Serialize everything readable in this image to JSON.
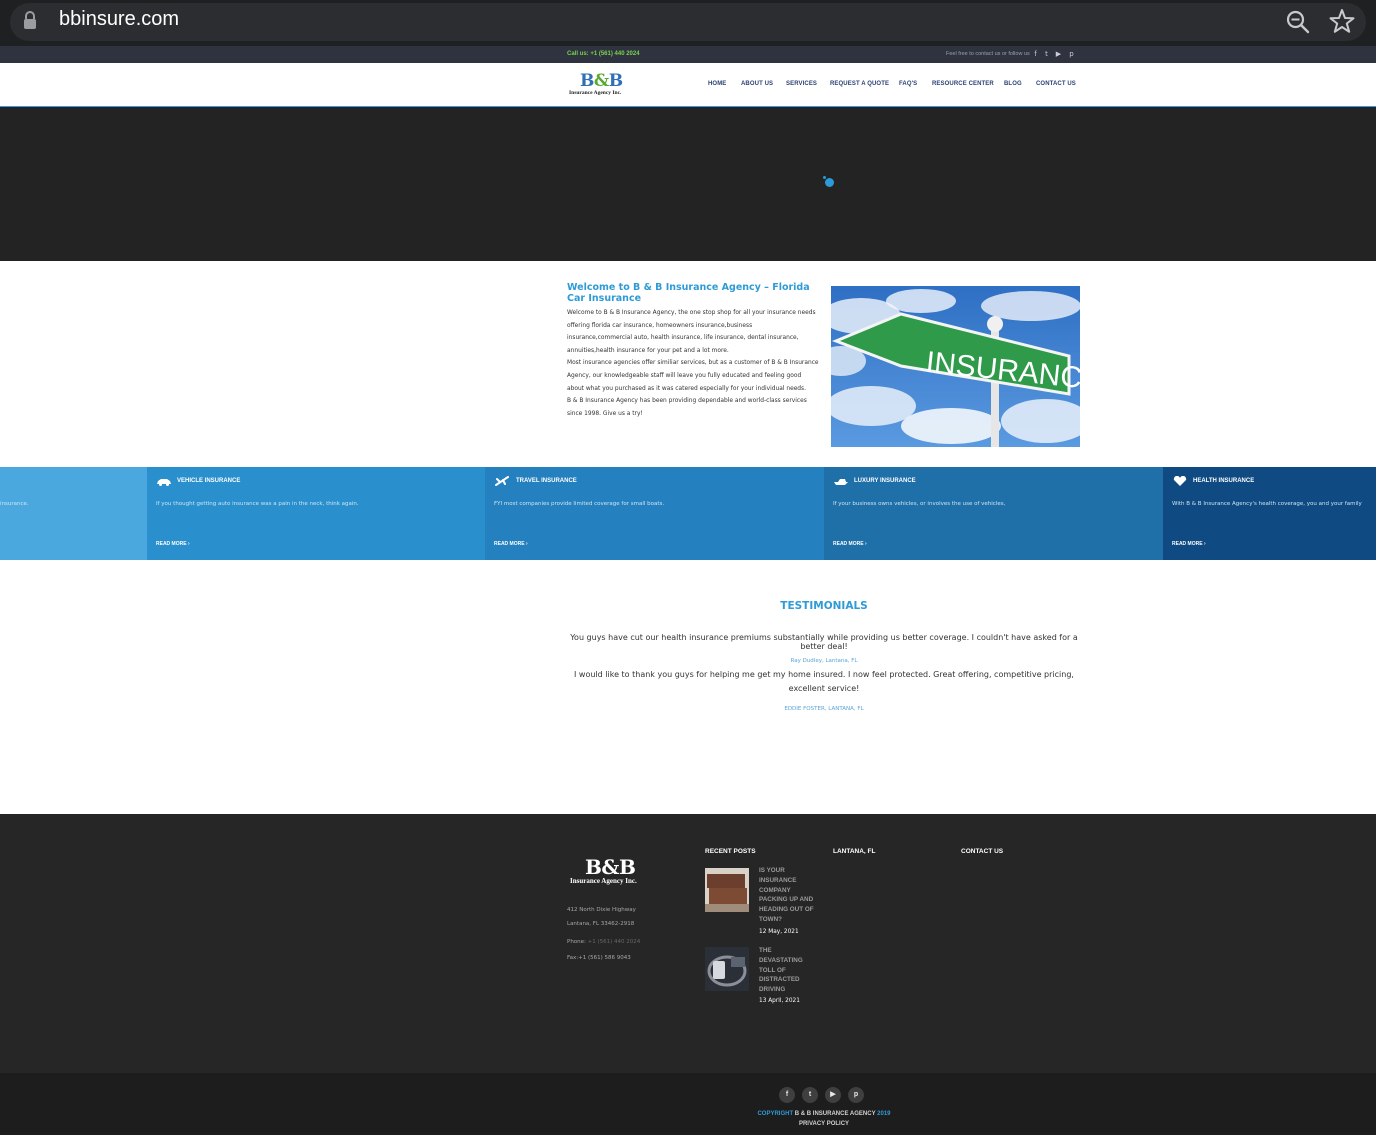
{
  "browser": {
    "url": "bbinsure.com",
    "icons": [
      "lock-icon",
      "zoom-out-icon",
      "star-bookmark-icon"
    ]
  },
  "topbar": {
    "call": "Call us: +1 (561) 440 2024",
    "follow": "Feel free to contact us or follow us",
    "social": [
      "facebook-icon",
      "twitter-icon",
      "youtube-icon",
      "pinterest-icon"
    ]
  },
  "header": {
    "logo_b1": "B",
    "logo_amp": "&",
    "logo_b2": "B",
    "logo_sub": "Insurance Agency Inc.",
    "nav": [
      "HOME",
      "ABOUT US",
      "SERVICES",
      "REQUEST A QUOTE",
      "FAQ'S",
      "RESOURCE CENTER",
      "BLOG",
      "CONTACT US"
    ]
  },
  "welcome": {
    "title": "Welcome to B & B Insurance Agency – Florida Car Insurance",
    "p1": "Welcome to B & B Insurance Agency, the one stop shop for all your insurance needs offering florida car insurance, homeowners insurance,business insurance,commercial auto, health insurance, life insurance, dental insurance, annuities,health insurance for your pet and a lot more.",
    "p2": "Most insurance agencies offer similiar services, but as a customer of B & B Insurance Agency, our knowledgeable staff will leave you fully educated and feeling good about what you purchased as it was catered especially for your individual needs.",
    "p3": "B & B Insurance Agency has been providing dependable and world-class services since 1998. Give us a try!",
    "image_sign_text": "INSURANCE"
  },
  "services": {
    "partial_text": "insurance.",
    "items": [
      {
        "title": "VEHICLE INSURANCE",
        "text": "If you thought getting auto insurance was a pain in the neck, think again.",
        "more": "READ MORE ›",
        "icon": "car-icon",
        "color": "#2a8fcd"
      },
      {
        "title": "TRAVEL INSURANCE",
        "text": "FYI most companies provide limited coverage for small boats.",
        "more": "READ MORE ›",
        "icon": "airplane-icon",
        "color": "#2480be"
      },
      {
        "title": "LUXURY INSURANCE",
        "text": "If your business owns vehicles, or involves the use of vehicles,",
        "more": "READ MORE ›",
        "icon": "yacht-icon",
        "color": "#1f6fa9"
      },
      {
        "title": "HEALTH INSURANCE",
        "text": "With B & B Insurance Agency's health coverage, you and your family",
        "more": "READ MORE ›",
        "icon": "heart-icon",
        "color": "#0f4a82"
      }
    ]
  },
  "testimonials": {
    "title": "TESTIMONIALS",
    "q1": "You guys have cut our health insurance premiums substantially while providing us better coverage. I couldn't have asked for a better deal!",
    "a1": "Ray Dudley, Lantana, FL",
    "q2": "I would like to thank you guys for helping me get my home insured. I now feel protected. Great offering, competitive pricing, excellent service!",
    "a2": "EDDIE FOSTER, LANTANA, FL"
  },
  "footer": {
    "logo": "B&B",
    "logo_sub": "Insurance Agency Inc.",
    "addr1": "412 North Dixie Highway",
    "addr2": "Lantana, FL 33462-2918",
    "phone_label": "Phone: ",
    "phone": "+1 (561) 440 2024",
    "fax": "Fax:+1 (561) 586 9043",
    "recent_posts": "RECENT POSTS",
    "lantana": "LANTANA, FL",
    "contact": "CONTACT US",
    "posts": [
      {
        "title": "IS YOUR INSURANCE COMPANY PACKING UP AND HEADING OUT OF TOWN?",
        "date": "12 May, 2021"
      },
      {
        "title": "THE DEVASTATING TOLL OF DISTRACTED DRIVING",
        "date": "13 April, 2021"
      }
    ],
    "social": [
      {
        "icon": "facebook-icon",
        "glyph": "f"
      },
      {
        "icon": "twitter-icon",
        "glyph": "t"
      },
      {
        "icon": "youtube-icon",
        "glyph": "▶"
      },
      {
        "icon": "pinterest-icon",
        "glyph": "p"
      }
    ],
    "copyright_a": "COPYRIGHT",
    "copyright_b": " B & B INSURANCE AGENCY ",
    "copyright_year": "2019",
    "privacy": "PRIVACY POLICY"
  }
}
